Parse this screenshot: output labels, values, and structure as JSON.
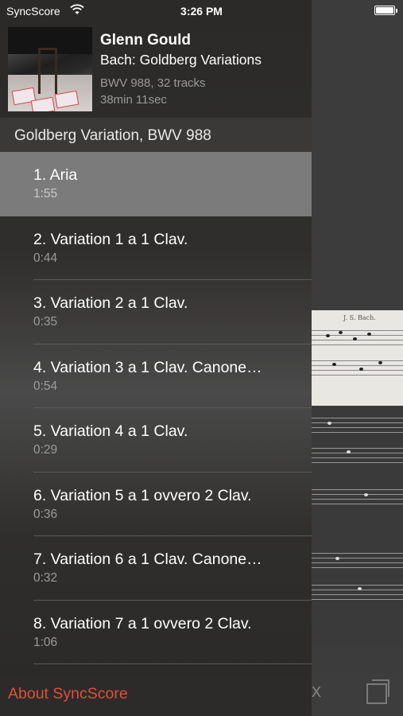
{
  "status_bar": {
    "carrier": "SyncScore",
    "time": "3:26 PM"
  },
  "album": {
    "artist": "Glenn Gould",
    "title": "Bach: Goldberg Variations",
    "meta": "BWV 988, 32 tracks",
    "duration": "38min 11sec"
  },
  "section": {
    "title": "Goldberg Variation, BWV 988"
  },
  "tracks": [
    {
      "title": "1. Aria",
      "time": "1:55"
    },
    {
      "title": "2. Variation 1 a 1 Clav.",
      "time": "0:44"
    },
    {
      "title": "3. Variation 2 a 1 Clav.",
      "time": "0:35"
    },
    {
      "title": "4. Variation 3 a 1 Clav. Canone…",
      "time": "0:54"
    },
    {
      "title": "5. Variation 4 a 1 Clav.",
      "time": "0:29"
    },
    {
      "title": "6. Variation 5 a 1 ovvero 2 Clav.",
      "time": "0:36"
    },
    {
      "title": "7. Variation 6 a 1 Clav. Canone…",
      "time": "0:32"
    },
    {
      "title": "8. Variation 7 a 1 ovvero 2 Clav.",
      "time": "1:06"
    }
  ],
  "footer": {
    "about_label": "About SyncScore"
  },
  "score": {
    "composer": "J. S. Bach."
  },
  "toolbar": {
    "close_glyph": "X"
  },
  "colors": {
    "accent": "#e0503a",
    "selected_row": "#7b7b7b"
  }
}
